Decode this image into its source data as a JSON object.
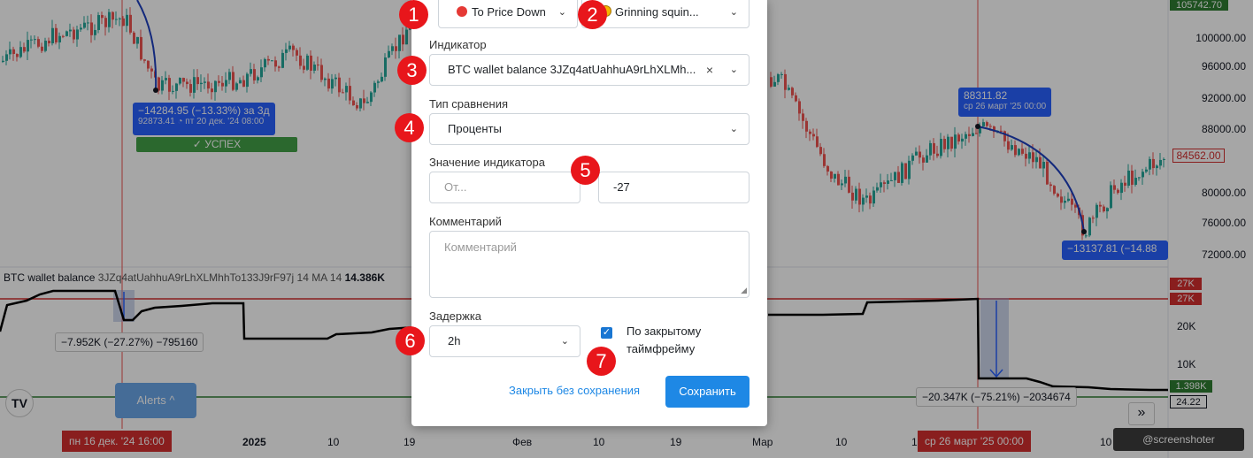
{
  "chart": {
    "price_axis": [
      "100000.00",
      "96000.00",
      "92000.00",
      "88000.00",
      "80000.00",
      "76000.00",
      "72000.00"
    ],
    "top_price": "105742.70",
    "current_price": "84562.00",
    "indicator_title": {
      "name": "BTC wallet balance",
      "address": "3JZq4atUahhuA9rLhXLMhhTo133J9rF97j 14 MA 14",
      "value": "14.386K"
    },
    "indicator_scale": {
      "tag_27k_a": "27K",
      "tag_27k_b": "27K",
      "label_20k": "20K",
      "label_10k": "10K",
      "tag_green": "1.398K",
      "tag_last": "24.22"
    },
    "annotation_left": {
      "main": "−14284.95 (−13.33%) за 3д",
      "sub": "92873.41 ◔ пт 20 дек. '24  08:00"
    },
    "success_label": "✓ УСПЕХ",
    "annotation_right": {
      "main": "88311.82",
      "sub": "ср 26 март '25  00:00"
    },
    "annotation_right_low": "−13137.81 (−14.88",
    "measure_left": "−7.952K (−27.27%) −795160",
    "measure_right": "−20.347K (−75.21%) −2034674",
    "time_axis": {
      "hl_left": "пн 16 дек. '24   16:00",
      "d_2025": "2025",
      "d_10a": "10",
      "d_19a": "19",
      "d_feb": "Фев",
      "d_10b": "10",
      "d_19b": "19",
      "d_mar": "Мар",
      "d_10c": "10",
      "d_1": "1",
      "hl_right": "ср 26 март '25   00:00",
      "d_10d": "10"
    },
    "tv_logo": "TV",
    "alerts_button": "Alerts ^",
    "nav_button": "»",
    "screenshoter": "@screenshoter",
    "colors": {
      "candle_up": "#26a69a",
      "candle_down": "#ef5350",
      "arc": "#1e3fbf",
      "hline_red": "#d32f2f",
      "hline_green": "#2e7d32"
    }
  },
  "modal": {
    "direction_select": "To Price Down",
    "emoji_select": "Grinning squin...",
    "indicator_label": "Индикатор",
    "indicator_select": "BTC wallet balance 3JZq4atUahhuA9rLhXLMh...",
    "clear_icon": "×",
    "compare_label": "Тип сравнения",
    "compare_select": "Проценты",
    "value_label": "Значение индикатора",
    "from_placeholder": "От...",
    "to_value": "-27",
    "comment_label": "Комментарий",
    "comment_placeholder": "Комментарий",
    "delay_label": "Задержка",
    "delay_select": "2h",
    "closed_tf_checkbox": "✓",
    "closed_tf_label": "По закрытому таймфрейму",
    "close_without_save": "Закрыть без сохранения",
    "save_button": "Сохранить"
  },
  "badges": [
    "1",
    "2",
    "3",
    "4",
    "5",
    "6",
    "7"
  ]
}
